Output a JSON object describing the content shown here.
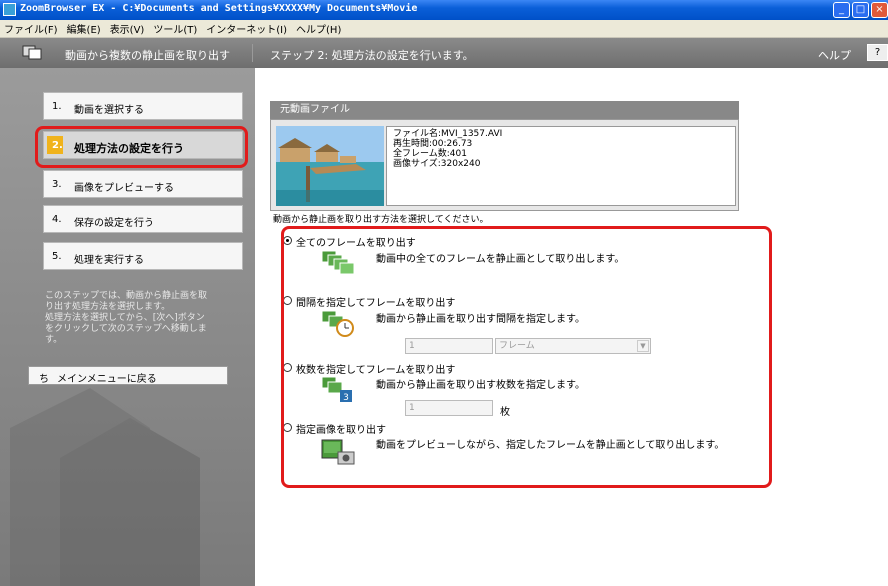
{
  "window": {
    "title": "ZoomBrowser EX - C:¥Documents and Settings¥XXXX¥My Documents¥Movie"
  },
  "menu": [
    "ファイル(F)",
    "編集(E)",
    "表示(V)",
    "ツール(T)",
    "インターネット(I)",
    "ヘルプ(H)"
  ],
  "header": {
    "title": "動画から複数の静止画を取り出す",
    "step": "ステップ 2: 処理方法の設定を行います。",
    "help": "ヘルプ",
    "help_btn": "?"
  },
  "steps": [
    {
      "num": "1.",
      "label": "動画を選択する"
    },
    {
      "num": "2.",
      "label": "処理方法の設定を行う",
      "active": true
    },
    {
      "num": "3.",
      "label": "画像をプレビューする"
    },
    {
      "num": "4.",
      "label": "保存の設定を行う"
    },
    {
      "num": "5.",
      "label": "処理を実行する"
    }
  ],
  "sidebar": {
    "description": [
      "このステップでは、動画から静止画を取",
      "り出す処理方法を選択します。",
      "処理方法を選択してから、[次へ]ボタン",
      "をクリックして次のステップへ移動しま",
      "す。"
    ],
    "back_icon": "ち",
    "back_label": "メインメニューに戻る"
  },
  "source": {
    "header": "元動画ファイル",
    "filename": "ファイル名:MVI_1357.AVI",
    "duration": "再生時間:00:26.73",
    "frames": "全フレーム数:401",
    "size": "画像サイズ:320x240"
  },
  "instruction": "動画から静止画を取り出す方法を選択してください。",
  "options": [
    {
      "label": "全てのフレームを取り出す",
      "desc": "動画中の全てのフレームを静止画として取り出します。",
      "selected": true
    },
    {
      "label": "間隔を指定してフレームを取り出す",
      "desc": "動画から静止画を取り出す間隔を指定します。",
      "value": "1",
      "unit": "フレーム"
    },
    {
      "label": "枚数を指定してフレームを取り出す",
      "desc": "動画から静止画を取り出す枚数を指定します。",
      "value": "1",
      "unit": "枚"
    },
    {
      "label": "指定画像を取り出す",
      "desc": "動画をプレビューしながら、指定したフレームを静止画として取り出します。"
    }
  ],
  "colors": {
    "highlight": "#e11b1b",
    "active_step": "#f0b31c",
    "titlebar": "#0a5fd8"
  }
}
